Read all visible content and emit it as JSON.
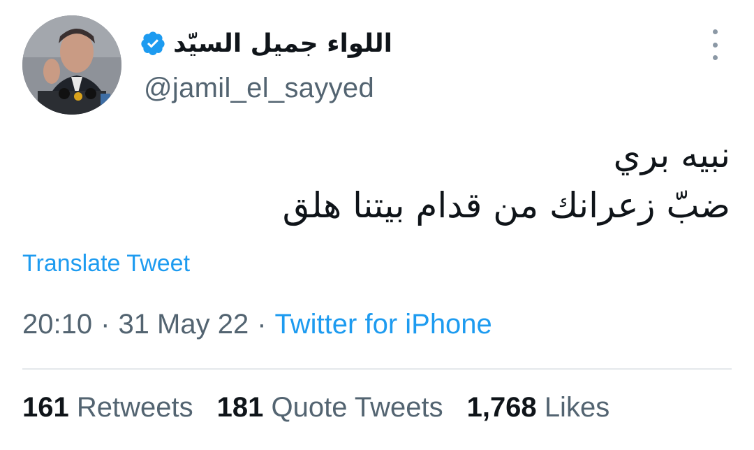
{
  "author": {
    "display_name": "اللواء جميل السيّد",
    "handle": "@jamil_el_sayyed",
    "verified": true
  },
  "tweet": {
    "lines": [
      "نبيه بري",
      "ضبّ زعرانك من قدام بيتنا هلق"
    ],
    "translate_label": "Translate Tweet",
    "time": "20:10",
    "date": "31 May 22",
    "source": "Twitter for iPhone"
  },
  "stats": {
    "retweets_count": "161",
    "retweets_label": "Retweets",
    "quotes_count": "181",
    "quotes_label": "Quote Tweets",
    "likes_count": "1,768",
    "likes_label": "Likes"
  },
  "colors": {
    "accent": "#1d9bf0",
    "secondary_text": "#536471",
    "primary_text": "#0f1419"
  },
  "icons": {
    "verified": "verified-badge-icon",
    "more": "more-options-icon"
  }
}
